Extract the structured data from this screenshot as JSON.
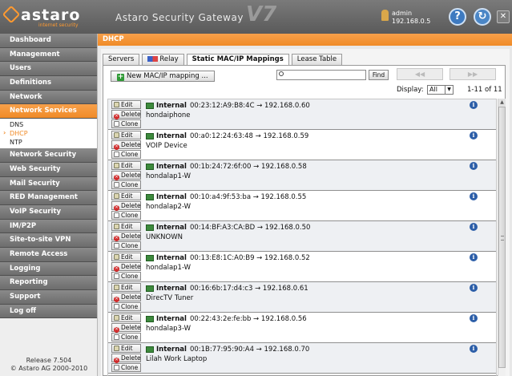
{
  "header": {
    "brand": "astaro",
    "tagline": "internet security",
    "title": "Astaro Security Gateway",
    "version_mark": "V7",
    "user": "admin",
    "host": "192.168.0.5",
    "help_icon": "help-icon",
    "refresh_icon": "refresh-icon",
    "close_icon": "close-icon"
  },
  "colors": {
    "accent": "#F08B28",
    "sidebar": "#7A7A7A",
    "info": "#2C5EA8"
  },
  "sidebar": {
    "items": [
      "Dashboard",
      "Management",
      "Users",
      "Definitions",
      "Network",
      "Network Services",
      "Network Security",
      "Web Security",
      "Mail Security",
      "RED Management",
      "VoIP Security",
      "IM/P2P",
      "Site-to-site VPN",
      "Remote Access",
      "Logging",
      "Reporting",
      "Support",
      "Log off"
    ],
    "subitems": [
      "DNS",
      "DHCP",
      "NTP"
    ],
    "release": "Release 7.504",
    "copyright": "© Astaro AG 2000-2010"
  },
  "page": {
    "title": "DHCP",
    "tabs": [
      "Servers",
      "Relay",
      "Static MAC/IP Mappings",
      "Lease Table"
    ],
    "new_button": "New MAC/IP mapping ...",
    "search_value": "",
    "find_label": "Find",
    "display_label": "Display:",
    "display_value": "All",
    "range": "1-11 of 11"
  },
  "actions": {
    "edit": "Edit",
    "delete": "Delete",
    "clone": "Clone"
  },
  "mappings": [
    {
      "iface": "Internal",
      "entry": "00:23:12:A9:B8:4C → 192.168.0.60",
      "name": "hondaiphone"
    },
    {
      "iface": "Internal",
      "entry": "00:a0:12:24:63:48 → 192.168.0.59",
      "name": "VOIP Device"
    },
    {
      "iface": "Internal",
      "entry": "00:1b:24:72:6f:00 → 192.168.0.58",
      "name": "hondalap1-W"
    },
    {
      "iface": "Internal",
      "entry": "00:10:a4:9f:53:ba → 192.168.0.55",
      "name": "hondalap2-W"
    },
    {
      "iface": "Internal",
      "entry": "00:14:BF:A3:CA:BD → 192.168.0.50",
      "name": "UNKNOWN"
    },
    {
      "iface": "Internal",
      "entry": "00:13:E8:1C:A0:B9 → 192.168.0.52",
      "name": "hondalap1-W"
    },
    {
      "iface": "Internal",
      "entry": "00:16:6b:17:d4:c3 → 192.168.0.61",
      "name": "DirecTV Tuner"
    },
    {
      "iface": "Internal",
      "entry": "00:22:43:2e:fe:bb → 192.168.0.56",
      "name": "hondalap3-W"
    },
    {
      "iface": "Internal",
      "entry": "00:1B:77:95:90:A4 → 192.168.0.70",
      "name": "Lilah Work Laptop"
    }
  ]
}
